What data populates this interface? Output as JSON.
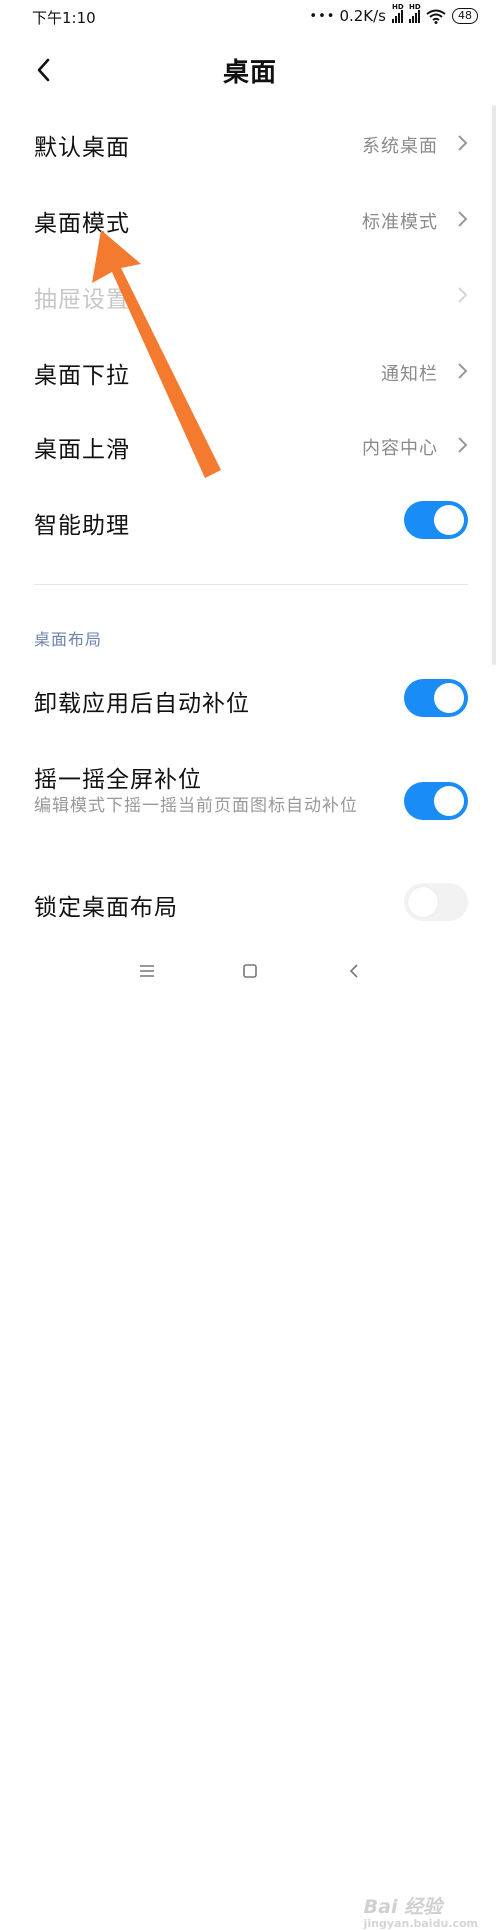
{
  "status_bar": {
    "time": "下午1:10",
    "network_speed": "0.2K/s",
    "hd_label": "HD",
    "battery": "48"
  },
  "header": {
    "title": "桌面"
  },
  "settings": {
    "default_desktop": {
      "title": "默认桌面",
      "value": "系统桌面"
    },
    "desktop_mode": {
      "title": "桌面模式",
      "value": "标准模式"
    },
    "drawer_settings": {
      "title": "抽屉设置",
      "enabled": false
    },
    "pull_down": {
      "title": "桌面下拉",
      "value": "通知栏"
    },
    "swipe_up": {
      "title": "桌面上滑",
      "value": "内容中心"
    },
    "smart_assistant": {
      "title": "智能助理",
      "on": true
    }
  },
  "layout_section": {
    "label": "桌面布局",
    "auto_fill": {
      "title": "卸载应用后自动补位",
      "on": true
    },
    "shake_fill": {
      "title": "摇一摇全屏补位",
      "subtitle": "编辑模式下摇一摇当前页面图标自动补位",
      "on": true
    },
    "lock_layout": {
      "title": "锁定桌面布局",
      "on": false
    }
  },
  "colors": {
    "toggle_on": "#1a8cf5",
    "annotation_arrow": "#f47a30"
  },
  "watermark": {
    "text": "Bai 经验",
    "sub": "jingyan.baidu.com"
  }
}
